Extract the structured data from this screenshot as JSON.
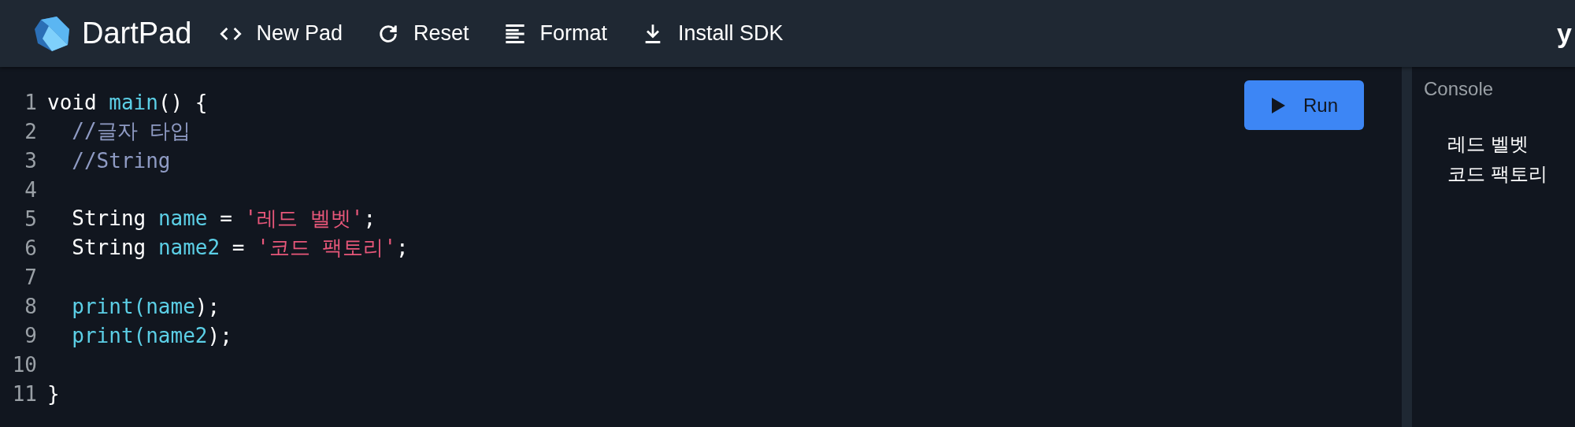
{
  "header": {
    "app_name": "DartPad",
    "actions": [
      {
        "kind": "code",
        "label": "New Pad"
      },
      {
        "kind": "reset",
        "label": "Reset"
      },
      {
        "kind": "format",
        "label": "Format"
      },
      {
        "kind": "download",
        "label": "Install SDK"
      }
    ],
    "user_text": "y"
  },
  "editor": {
    "lines": [
      {
        "number": "1",
        "indented": false,
        "tokens": [
          {
            "kind": "plain",
            "text": "void "
          },
          {
            "kind": "ident",
            "text": "main"
          },
          {
            "kind": "plain",
            "text": "() {"
          }
        ]
      },
      {
        "number": "2",
        "indented": true,
        "tokens": [
          {
            "kind": "comment",
            "text": "//글자 타입"
          }
        ]
      },
      {
        "number": "3",
        "indented": true,
        "tokens": [
          {
            "kind": "comment",
            "text": "//String"
          }
        ]
      },
      {
        "number": "4"
      },
      {
        "number": "5",
        "indented": true,
        "tokens": [
          {
            "kind": "plain",
            "text": "String "
          },
          {
            "kind": "ident",
            "text": "name"
          },
          {
            "kind": "plain",
            "text": " = "
          },
          {
            "kind": "string",
            "text": "'레드 벨벳'"
          },
          {
            "kind": "plain",
            "text": ";"
          }
        ]
      },
      {
        "number": "6",
        "indented": true,
        "tokens": [
          {
            "kind": "plain",
            "text": "String "
          },
          {
            "kind": "ident",
            "text": "name2"
          },
          {
            "kind": "plain",
            "text": " = "
          },
          {
            "kind": "string",
            "text": "'코드 팩토리'"
          },
          {
            "kind": "plain",
            "text": ";"
          }
        ]
      },
      {
        "number": "7"
      },
      {
        "number": "8",
        "indented": true,
        "tokens": [
          {
            "kind": "ident",
            "text": "print(name"
          },
          {
            "kind": "plain",
            "text": ");"
          }
        ]
      },
      {
        "number": "9",
        "indented": true,
        "tokens": [
          {
            "kind": "ident",
            "text": "print(name2"
          },
          {
            "kind": "plain",
            "text": ");"
          }
        ]
      },
      {
        "number": "10"
      },
      {
        "number": "11",
        "indented": false,
        "tokens": [
          {
            "kind": "plain",
            "text": "}"
          }
        ]
      }
    ],
    "run_button": "Run"
  },
  "console": {
    "title": "Console",
    "output": [
      "레드 벨벳",
      "코드 팩토리"
    ]
  }
}
